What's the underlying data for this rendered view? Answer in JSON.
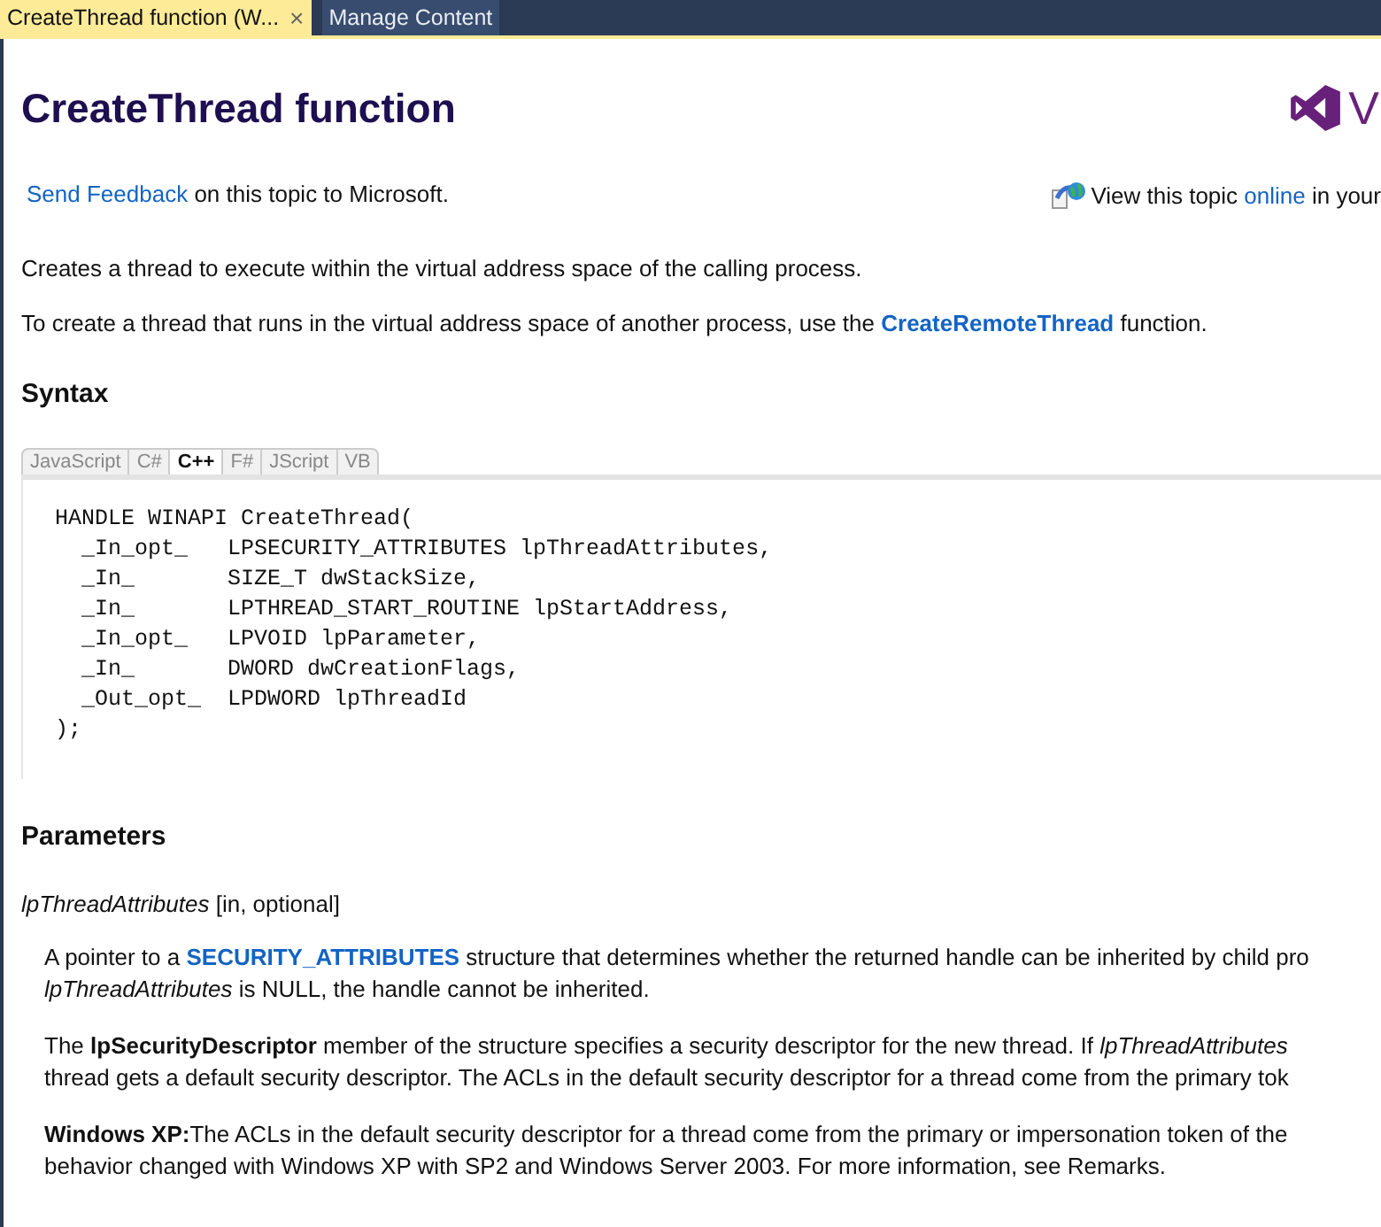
{
  "tabs": [
    {
      "label": "CreateThread function (W...",
      "selected": true,
      "close": "×"
    },
    {
      "label": "Manage Content",
      "selected": false
    }
  ],
  "header": {
    "title": "CreateThread function",
    "logo_text": "V"
  },
  "feedback": [
    {
      "kind": "link",
      "text": "Send Feedback"
    },
    {
      "kind": "text",
      "text": " on this topic to Microsoft."
    }
  ],
  "online": [
    {
      "kind": "text",
      "text": "View this topic "
    },
    {
      "kind": "link",
      "text": "online"
    },
    {
      "kind": "text",
      "text": " in your"
    }
  ],
  "intro": [
    [
      {
        "kind": "text",
        "text": "Creates a thread to execute within the virtual address space of the calling process."
      }
    ],
    [
      {
        "kind": "text",
        "text": "To create a thread that runs in the virtual address space of another process, use the "
      },
      {
        "kind": "strong-link",
        "text": "CreateRemoteThread"
      },
      {
        "kind": "text",
        "text": " function."
      }
    ]
  ],
  "syntax": {
    "heading": "Syntax",
    "languages": [
      {
        "label": "JavaScript",
        "selected": false
      },
      {
        "label": "C#",
        "selected": false
      },
      {
        "label": "C++",
        "selected": true
      },
      {
        "label": "F#",
        "selected": false
      },
      {
        "label": "JScript",
        "selected": false
      },
      {
        "label": "VB",
        "selected": false
      }
    ],
    "code": [
      "HANDLE WINAPI CreateThread(",
      "  _In_opt_   LPSECURITY_ATTRIBUTES lpThreadAttributes,",
      "  _In_       SIZE_T dwStackSize,",
      "  _In_       LPTHREAD_START_ROUTINE lpStartAddress,",
      "  _In_opt_   LPVOID lpParameter,",
      "  _In_       DWORD dwCreationFlags,",
      "  _Out_opt_  LPDWORD lpThreadId",
      ");"
    ]
  },
  "parameters": {
    "heading": "Parameters",
    "name": "*lpThreadAttributes* [in, optional]",
    "paragraphs": [
      [
        [
          {
            "kind": "text",
            "text": "A pointer to a "
          },
          {
            "kind": "strong-link",
            "text": "SECURITY_ATTRIBUTES"
          },
          {
            "kind": "text",
            "text": " structure that determines whether the returned handle can be inherited by child pro"
          }
        ],
        [
          {
            "kind": "text",
            "text": "*lpThreadAttributes* is NULL, the handle cannot be inherited."
          }
        ]
      ],
      [
        [
          {
            "kind": "text",
            "text": "The **lpSecurityDescriptor** member of the structure specifies a security descriptor for the new thread. If *lpThreadAttributes*"
          }
        ],
        [
          {
            "kind": "text",
            "text": "thread gets a default security descriptor. The ACLs in the default security descriptor for a thread come from the primary tok"
          }
        ]
      ],
      [
        [
          {
            "kind": "text",
            "text": "**Windows XP:**The ACLs in the default security descriptor for a thread come from the primary or impersonation token of the"
          }
        ],
        [
          {
            "kind": "text",
            "text": "behavior changed with Windows XP with SP2 and Windows Server 2003. For more information, see Remarks."
          }
        ]
      ]
    ]
  }
}
